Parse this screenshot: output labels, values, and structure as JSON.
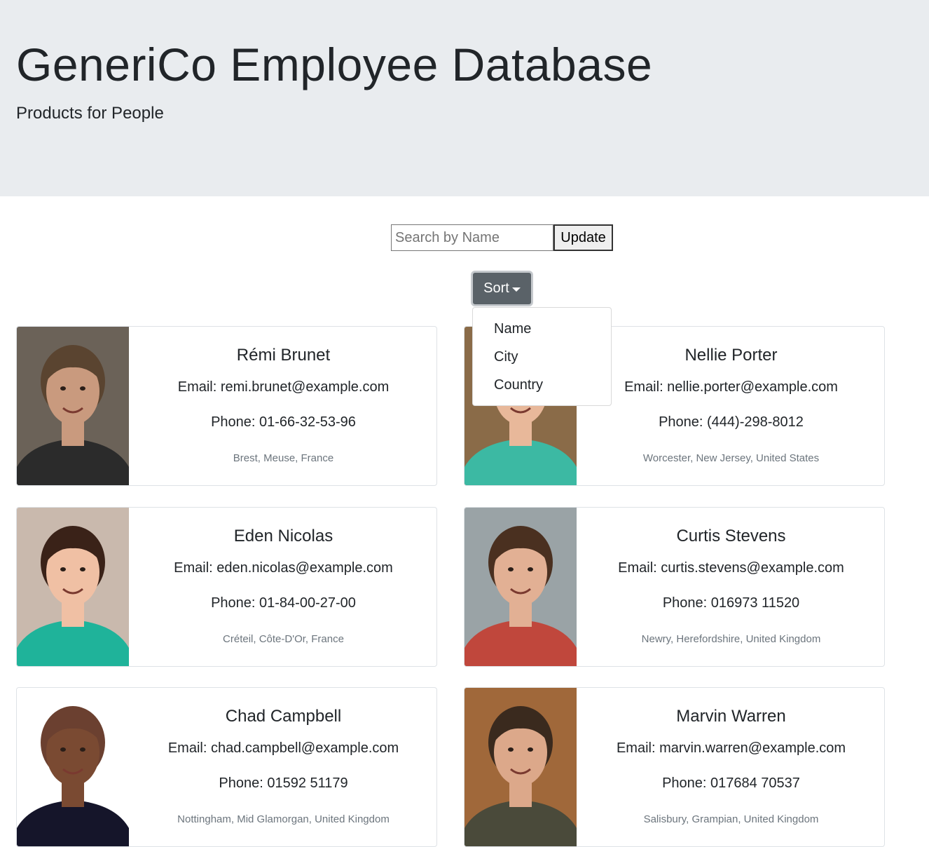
{
  "header": {
    "title": "GeneriCo Employee Database",
    "subtitle": "Products for People"
  },
  "search": {
    "placeholder": "Search by Name",
    "value": "",
    "update_label": "Update"
  },
  "sort": {
    "label": "Sort",
    "options": [
      "Name",
      "City",
      "Country"
    ]
  },
  "employees": [
    {
      "name": "Rémi Brunet",
      "email": "Email: remi.brunet@example.com",
      "phone": "Phone: 01-66-32-53-96",
      "location": "Brest, Meuse, France",
      "photo": {
        "bg": "#6b6258",
        "skin": "#c99a7e",
        "hair": "#5a4430",
        "shirt": "#2b2b2b"
      }
    },
    {
      "name": "Nellie Porter",
      "email": "Email: nellie.porter@example.com",
      "phone": "Phone: (444)-298-8012",
      "location": "Worcester, New Jersey, United States",
      "photo": {
        "bg": "#8a6b48",
        "skin": "#e8b89a",
        "hair": "#d9b26a",
        "shirt": "#3cb9a3"
      }
    },
    {
      "name": "Eden Nicolas",
      "email": "Email: eden.nicolas@example.com",
      "phone": "Phone: 01-84-00-27-00",
      "location": "Créteil, Côte-D'Or, France",
      "photo": {
        "bg": "#c9b9ad",
        "skin": "#f0c0a4",
        "hair": "#3a2218",
        "shirt": "#1fb39a"
      }
    },
    {
      "name": "Curtis Stevens",
      "email": "Email: curtis.stevens@example.com",
      "phone": "Phone: 016973 11520",
      "location": "Newry, Herefordshire, United Kingdom",
      "photo": {
        "bg": "#9aa3a6",
        "skin": "#e2b094",
        "hair": "#4a3020",
        "shirt": "#c0473c"
      }
    },
    {
      "name": "Chad Campbell",
      "email": "Email: chad.campbell@example.com",
      "phone": "Phone: 01592 51179",
      "location": "Nottingham, Mid Glamorgan, United Kingdom",
      "photo": {
        "bg": "#ffffff",
        "skin": "#7a4a32",
        "hair": "#6b4030",
        "shirt": "#15152a"
      }
    },
    {
      "name": "Marvin Warren",
      "email": "Email: marvin.warren@example.com",
      "phone": "Phone: 017684 70537",
      "location": "Salisbury, Grampian, United Kingdom",
      "photo": {
        "bg": "#a0683a",
        "skin": "#dca88a",
        "hair": "#3a2a1e",
        "shirt": "#4a4a3a"
      }
    }
  ]
}
